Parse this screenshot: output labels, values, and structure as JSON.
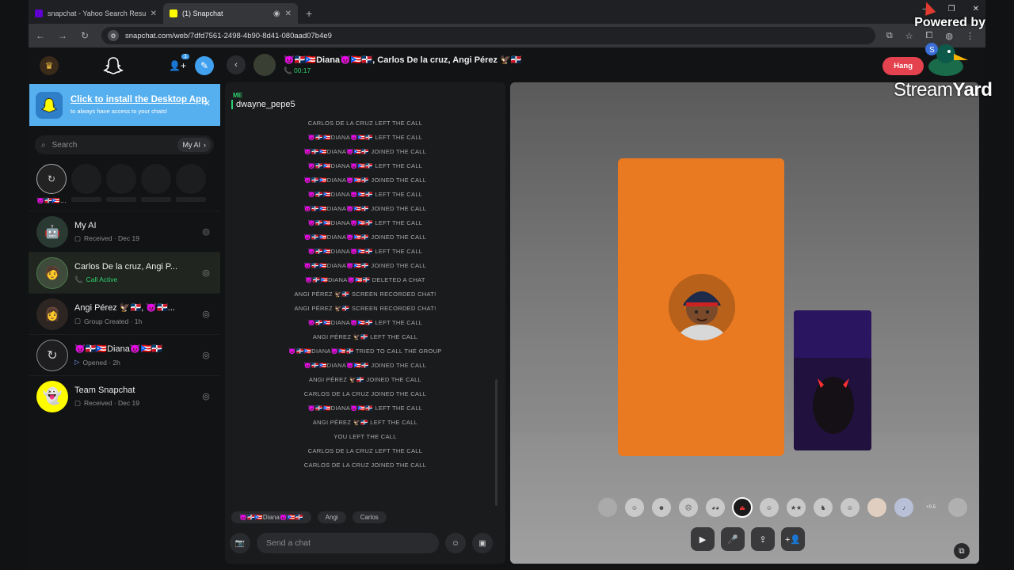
{
  "browser": {
    "tabs": [
      {
        "title": "snapchat - Yahoo Search Results",
        "favicon_color": "#6001d2",
        "favicon_letter": "Y"
      },
      {
        "title": "(1) Snapchat",
        "favicon_color": "#fffc00",
        "favicon_letter": ""
      }
    ],
    "url": "snapchat.com/web/7dfd7561-2498-4b90-8d41-080aad07b4e9"
  },
  "watermark": {
    "powered_by": "Powered by",
    "brand_a": "Stream",
    "brand_b": "Yard"
  },
  "sidebar": {
    "notification_count": "1",
    "banner": {
      "title": "Click to install the Desktop App",
      "subtitle": "to always have access to your chats!"
    },
    "search": {
      "placeholder": "Search",
      "myai_label": "My AI"
    },
    "story_label": "😈🇩🇴🇵🇷…",
    "chats": [
      {
        "name": "My AI",
        "status": "Received · Dec 19",
        "status_icon": "▢",
        "highlight": false
      },
      {
        "name": "Carlos De la cruz,  Angi P...",
        "status": "Call Active",
        "status_icon": "📞",
        "highlight": true
      },
      {
        "name": "Angi Pérez 🦅🇩🇴,  😈🇩🇴...",
        "status": "Group Created · 1h",
        "status_icon": "▢",
        "highlight": false
      },
      {
        "name": "😈🇩🇴🇵🇷Diana😈🇵🇷🇩🇴",
        "status": "Opened · 2h",
        "status_icon": "▷",
        "highlight": false
      },
      {
        "name": "Team Snapchat",
        "status": "Received · Dec 19",
        "status_icon": "▢",
        "highlight": false
      }
    ]
  },
  "chat_header": {
    "title": "😈🇩🇴🇵🇷Diana😈🇵🇷🇩🇴,  Carlos De la cruz,  Angi Pérez 🦅🇩🇴",
    "timer": "00:17",
    "hang_label": "Hang"
  },
  "chat": {
    "me_label": "ME",
    "me_username": "dwayne_pepe5",
    "events": [
      "CARLOS DE LA CRUZ LEFT THE CALL",
      "😈🇩🇴🇵🇷DIANA😈🇵🇷🇩🇴 LEFT THE CALL",
      "😈🇩🇴🇵🇷DIANA😈🇵🇷🇩🇴 JOINED THE CALL",
      "😈🇩🇴🇵🇷DIANA😈🇵🇷🇩🇴 LEFT THE CALL",
      "😈🇩🇴🇵🇷DIANA😈🇵🇷🇩🇴 JOINED THE CALL",
      "😈🇩🇴🇵🇷DIANA😈🇵🇷🇩🇴 LEFT THE CALL",
      "😈🇩🇴🇵🇷DIANA😈🇵🇷🇩🇴 JOINED THE CALL",
      "😈🇩🇴🇵🇷DIANA😈🇵🇷🇩🇴 LEFT THE CALL",
      "😈🇩🇴🇵🇷DIANA😈🇵🇷🇩🇴 JOINED THE CALL",
      "😈🇩🇴🇵🇷DIANA😈🇵🇷🇩🇴 LEFT THE CALL",
      "😈🇩🇴🇵🇷DIANA😈🇵🇷🇩🇴 JOINED THE CALL",
      "😈🇩🇴🇵🇷DIANA😈🇵🇷🇩🇴 DELETED A CHAT",
      "ANGI PÉREZ 🦅🇩🇴 SCREEN RECORDED CHAT!",
      "ANGI PÉREZ 🦅🇩🇴 SCREEN RECORDED CHAT!",
      "😈🇩🇴🇵🇷DIANA😈🇵🇷🇩🇴 LEFT THE CALL",
      "ANGI PÉREZ 🦅🇩🇴 LEFT THE CALL",
      "😈🇩🇴🇵🇷DIANA😈🇵🇷🇩🇴 TRIED TO CALL THE GROUP",
      "😈🇩🇴🇵🇷DIANA😈🇵🇷🇩🇴 JOINED THE CALL",
      "ANGI PÉREZ 🦅🇩🇴 JOINED THE CALL",
      "CARLOS DE LA CRUZ JOINED THE CALL",
      "😈🇩🇴🇵🇷DIANA😈🇵🇷🇩🇴 LEFT THE CALL",
      "ANGI PÉREZ 🦅🇩🇴 LEFT THE CALL",
      "YOU LEFT THE CALL",
      "CARLOS DE LA CRUZ LEFT THE CALL",
      "CARLOS DE LA CRUZ JOINED THE CALL"
    ],
    "participant_chips": [
      "😈🇩🇴🇵🇷Diana😈🇵🇷🇩🇴",
      "Angi",
      "Carlos"
    ],
    "input_placeholder": "Send a chat"
  },
  "call": {
    "tile_color": "#ea7a22",
    "lens_badge": "+0.5"
  }
}
